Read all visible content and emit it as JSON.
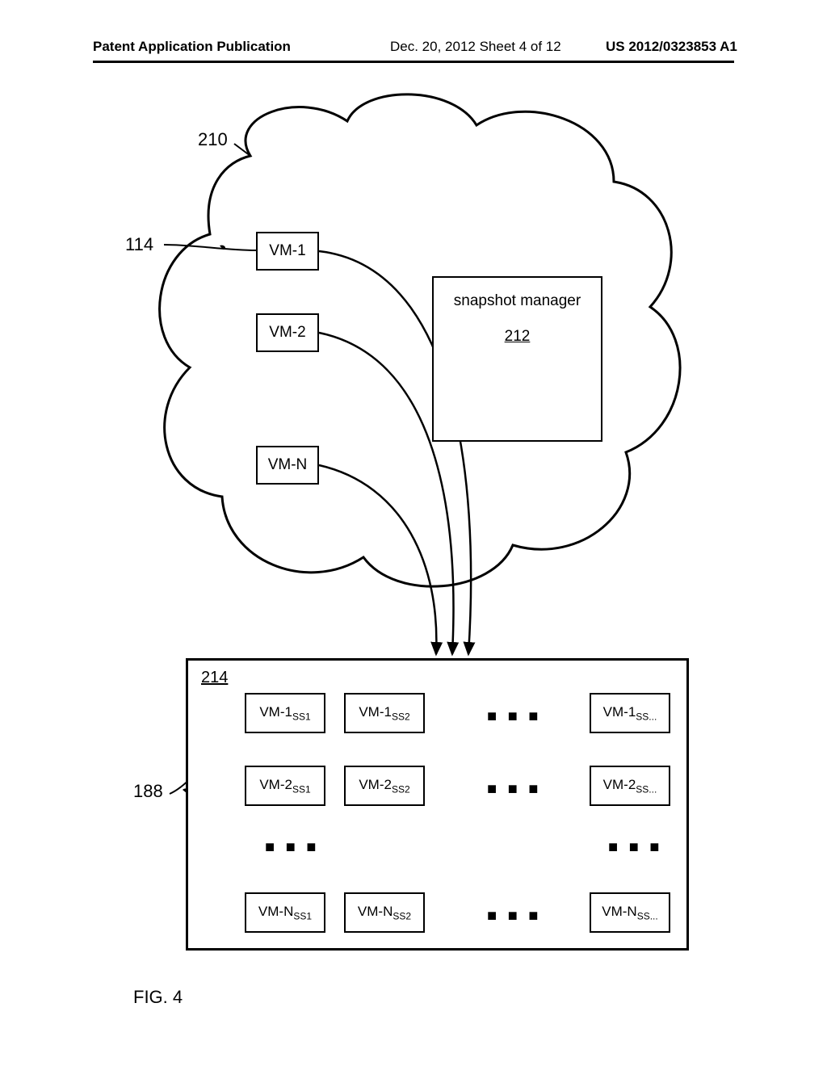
{
  "header": {
    "left": "Patent Application Publication",
    "center": "Dec. 20, 2012   Sheet 4 of 12",
    "right": "US 2012/0323853 A1"
  },
  "labels": {
    "cloud_ref": "210",
    "vm_ref": "114",
    "storage_ref": "188",
    "storage_inner_ref": "214",
    "snapshot_mgr_title": "snapshot manager",
    "snapshot_mgr_ref": "212"
  },
  "vms": {
    "vm1": "VM-1",
    "vm2": "VM-2",
    "vmn": "VM-N"
  },
  "snapshots": {
    "vm1_ss1_a": "VM-1",
    "vm1_ss1_b": "SS1",
    "vm1_ss2_a": "VM-1",
    "vm1_ss2_b": "SS2",
    "vm1_ssn_a": "VM-1",
    "vm1_ssn_b": "SS...",
    "vm2_ss1_a": "VM-2",
    "vm2_ss1_b": "SS1",
    "vm2_ss2_a": "VM-2",
    "vm2_ss2_b": "SS2",
    "vm2_ssn_a": "VM-2",
    "vm2_ssn_b": "SS...",
    "vmn_ss1_a": "VM-N",
    "vmn_ss1_b": "SS1",
    "vmn_ss2_a": "VM-N",
    "vmn_ss2_b": "SS2",
    "vmn_ssn_a": "VM-N",
    "vmn_ssn_b": "SS..."
  },
  "figure_caption": "FIG. 4"
}
